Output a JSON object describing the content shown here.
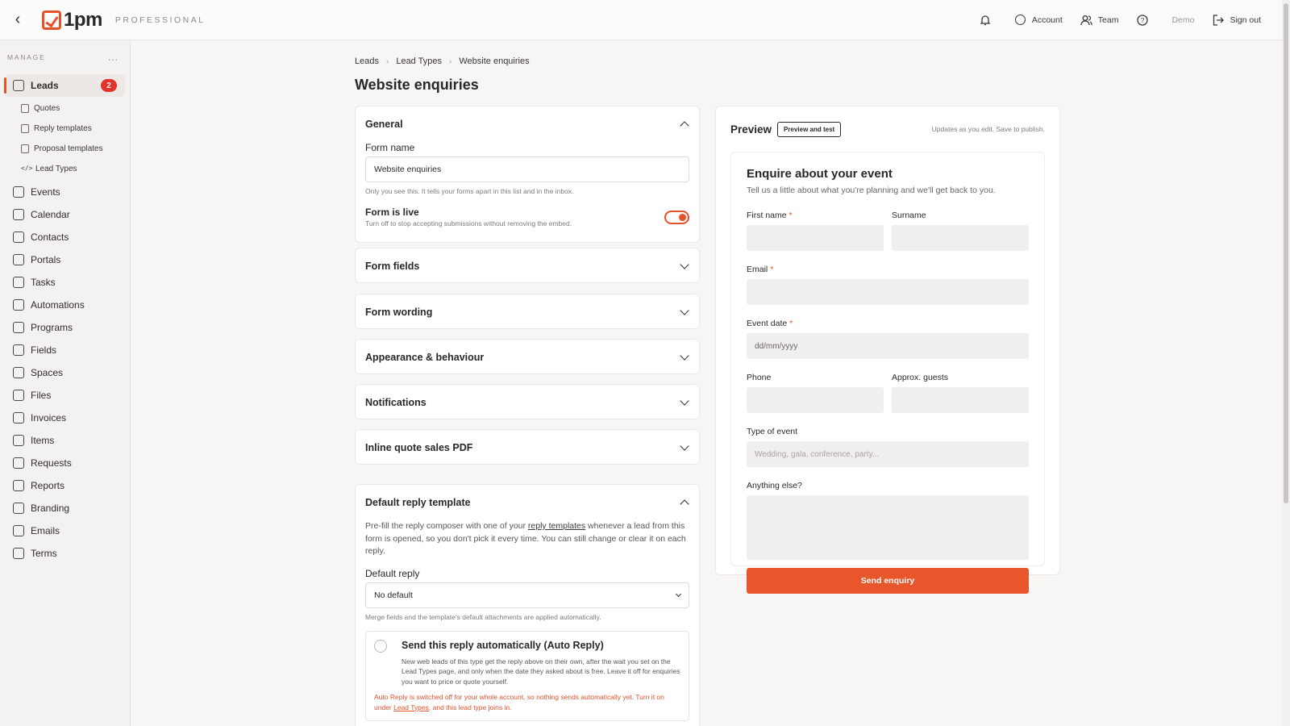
{
  "header": {
    "logo_text": "1pm",
    "plan": "PROFESSIONAL",
    "actions": [
      {
        "label": "",
        "icon": "bell-icon"
      },
      {
        "label": "Account",
        "icon": "account-icon"
      },
      {
        "label": "Team",
        "icon": "team-icon"
      },
      {
        "label": "",
        "icon": "help-icon"
      },
      {
        "label": "Demo",
        "icon": ""
      },
      {
        "label": "Sign out",
        "icon": "sign-out-icon"
      }
    ]
  },
  "sidebar": {
    "section_label": "MANAGE",
    "more": "...",
    "leads": {
      "label": "Leads",
      "badge": "2"
    },
    "sub_items": [
      "Quotes",
      "Reply templates",
      "Proposal templates",
      "Lead Types"
    ],
    "items": [
      "Events",
      "Calendar",
      "Contacts",
      "Portals",
      "Tasks",
      "Automations",
      "Programs",
      "Fields",
      "Spaces",
      "Files",
      "Invoices",
      "Items",
      "Requests",
      "Reports",
      "Branding",
      "Emails",
      "Terms"
    ]
  },
  "breadcrumb": [
    "Leads",
    "Lead Types",
    "Website enquiries"
  ],
  "page_title": "Website enquiries",
  "general": {
    "title": "General",
    "form_name_label": "Form name",
    "form_name_value": "Website enquiries",
    "form_name_help": "Only you see this. It tells your forms apart in this list and in the inbox.",
    "live_title": "Form is live",
    "live_help": "Turn off to stop accepting submissions without removing the embed.",
    "live_on": true
  },
  "sections": [
    "Form fields",
    "Form wording",
    "Appearance & behaviour",
    "Notifications",
    "Inline quote sales PDF"
  ],
  "reply": {
    "title": "Default reply template",
    "desc_before": "Pre-fill the reply composer with one of your ",
    "desc_link": "reply templates",
    "desc_after": " whenever a lead from this form is opened, so you don't pick it every time. You can still change or clear it on each reply.",
    "default_label": "Default reply",
    "default_value": "No default",
    "default_help": "Merge fields and the template's default attachments are applied automatically.",
    "auto_title": "Send this reply automatically (Auto Reply)",
    "auto_desc": "New web leads of this type get the reply above on their own, after the wait you set on the Lead Types page, and only when the date they asked about is free. Leave it off for enquiries you want to price or quote yourself.",
    "warn_before": "Auto Reply is switched off for your whole account, so nothing sends automatically yet. Turn it on under ",
    "warn_link": "Lead Types",
    "warn_after": ", and this lead type joins in."
  },
  "preview": {
    "title": "Preview",
    "button": "Preview and test",
    "note": "Updates as you edit. Save to publish.",
    "form_title": "Enquire about your event",
    "form_sub": "Tell us a little about what you're planning and we'll get back to you.",
    "first_name": "First name",
    "surname": "Surname",
    "email": "Email",
    "event_date": "Event date",
    "event_date_ph": "dd/mm/yyyy",
    "phone": "Phone",
    "guests": "Approx. guests",
    "type": "Type of event",
    "type_ph": "Wedding, gala, conference, party...",
    "anything": "Anything else?",
    "submit": "Send enquiry",
    "required_mark": "*"
  }
}
